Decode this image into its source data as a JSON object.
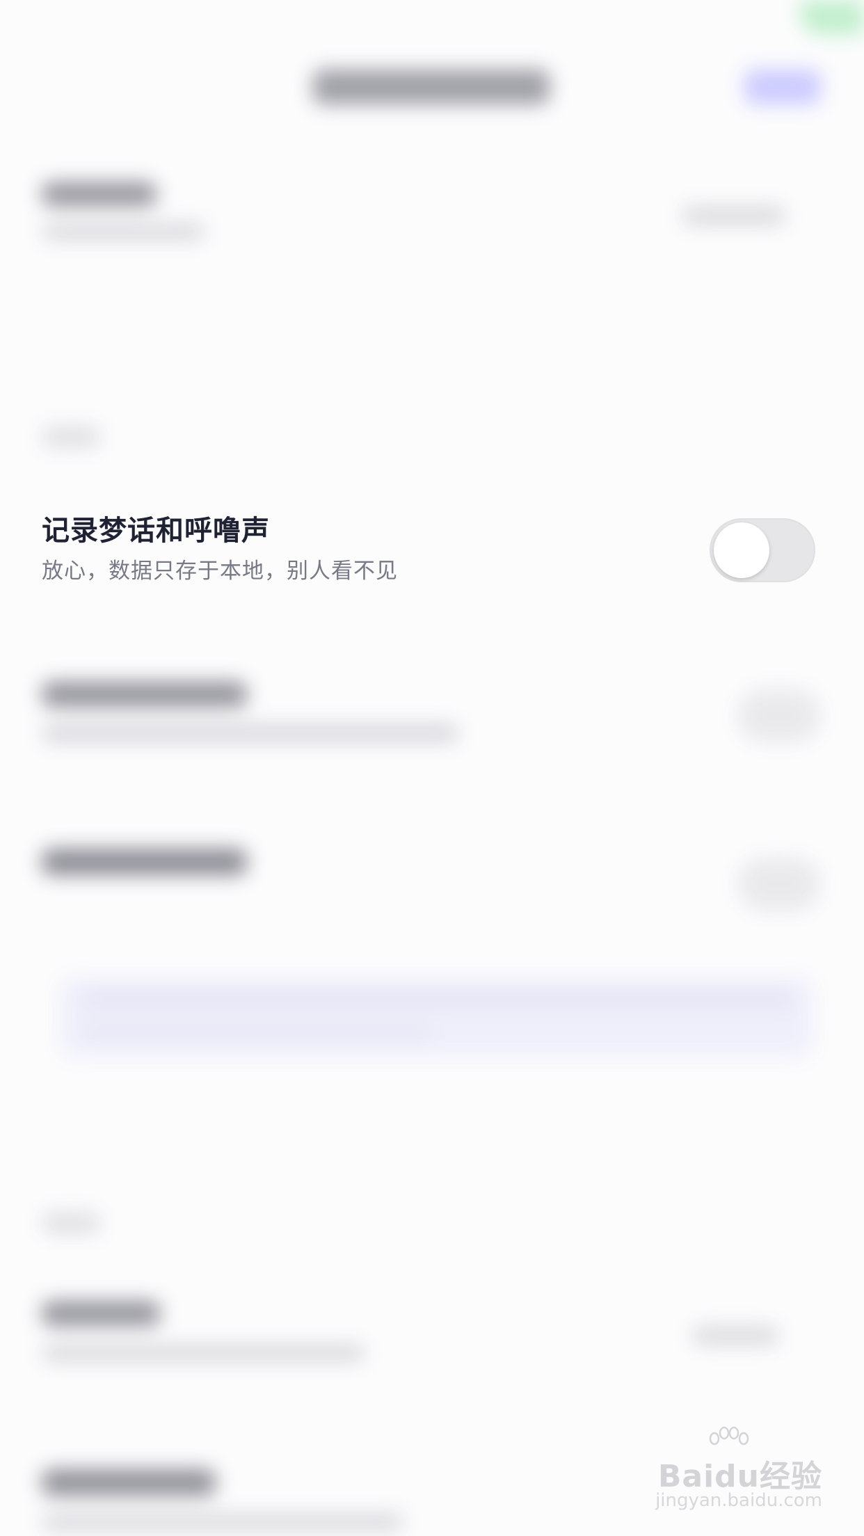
{
  "setting": {
    "title": "记录梦话和呼噜声",
    "subtitle": "放心，数据只存于本地，别人看不见",
    "enabled": false
  },
  "watermark": {
    "brand": "Baidu经验",
    "url": "jingyan.baidu.com"
  },
  "colors": {
    "title": "#1f2233",
    "subtitle": "#777a86",
    "toggle_track": "#e6e6e8",
    "toggle_knob": "#ffffff",
    "accent_blurred": "#c9c8ff",
    "status_green": "#bfeecb"
  }
}
